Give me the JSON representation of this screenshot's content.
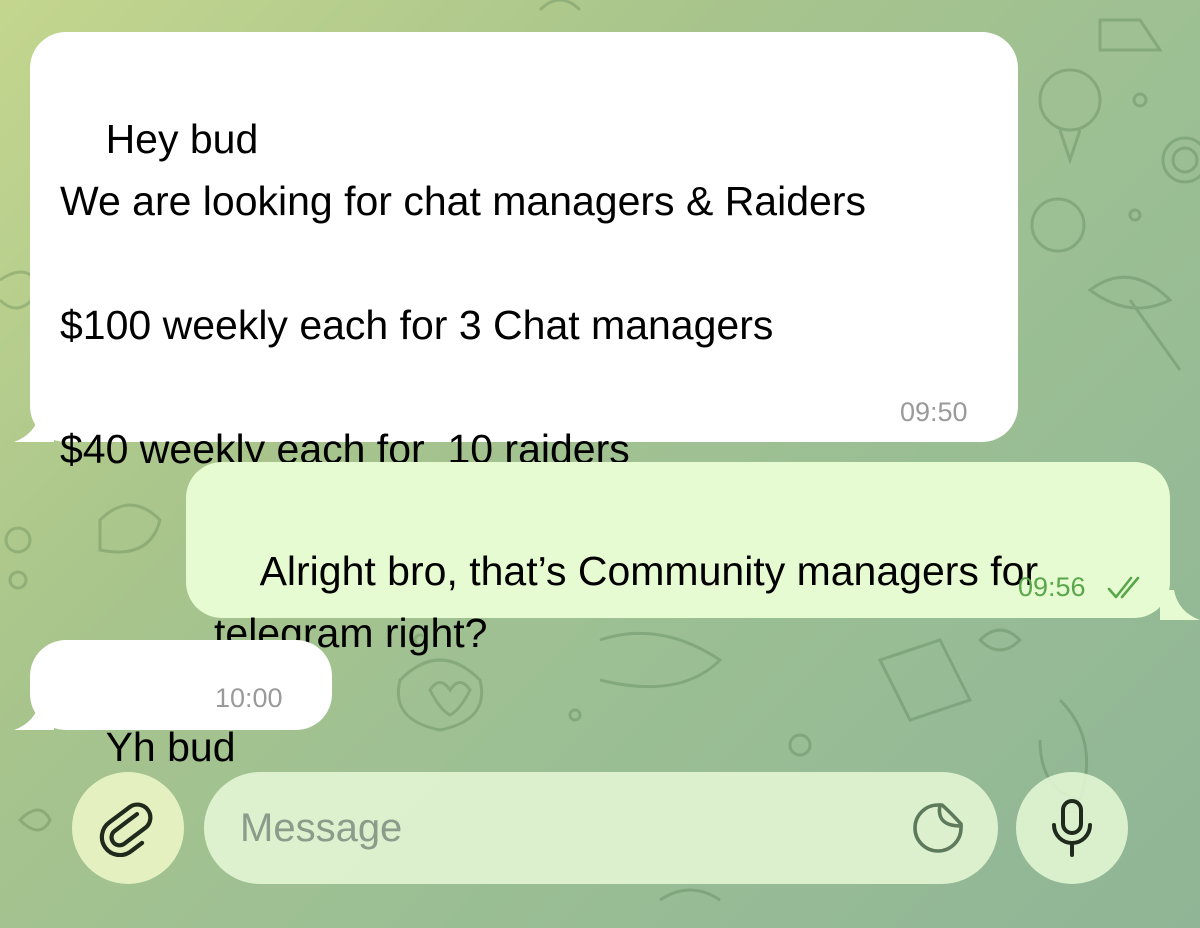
{
  "messages": [
    {
      "direction": "incoming",
      "text": "Hey bud\nWe are looking for chat managers & Raiders\n\n$100 weekly each for 3 Chat managers\n\n$40 weekly each for  10 raiders",
      "time": "09:50"
    },
    {
      "direction": "outgoing",
      "text": "Alright bro, that’s Community managers for telegram right?",
      "time": "09:56",
      "status_icon": "double-check-icon"
    },
    {
      "direction": "incoming",
      "text": "Yh bud",
      "time": "10:00"
    }
  ],
  "composer": {
    "placeholder": "Message",
    "attach_icon": "paperclip-icon",
    "sticker_icon": "sticker-icon",
    "voice_icon": "microphone-icon"
  },
  "colors": {
    "incoming_bubble": "#ffffff",
    "outgoing_bubble": "#e7fbd2",
    "outgoing_time": "#5aa64a",
    "incoming_time": "#9a9a9a"
  }
}
